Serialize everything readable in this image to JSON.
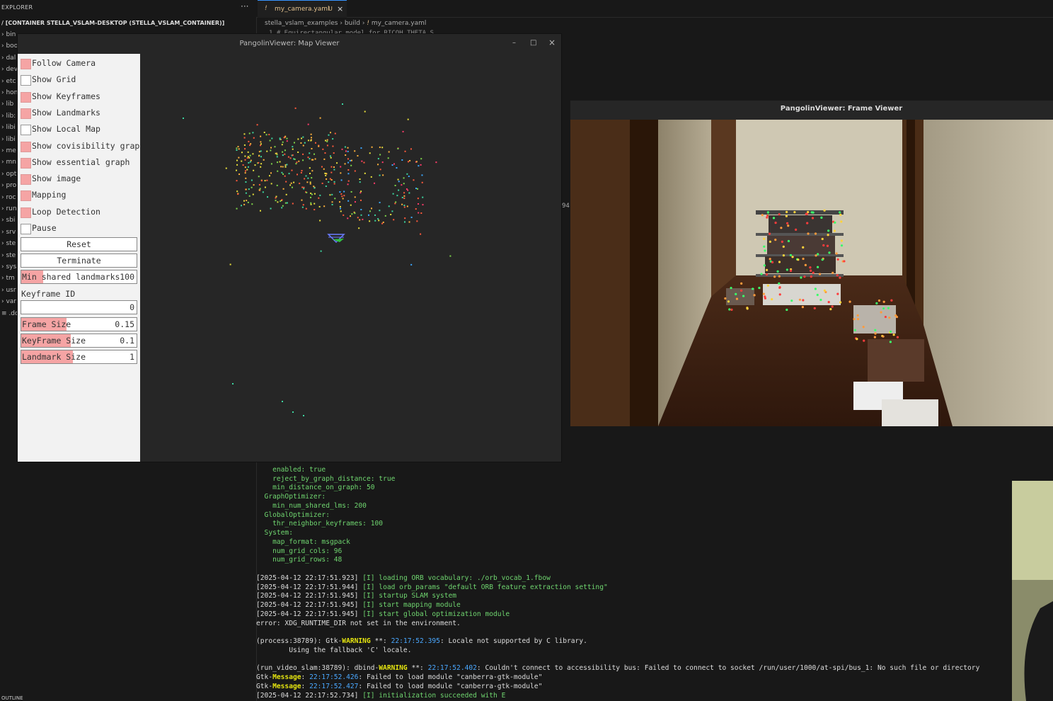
{
  "explorer": {
    "title": "EXPLORER",
    "more": "···",
    "root": "/ [CONTAINER STELLA_VSLAM-DESKTOP (STELLA_VSLAM_CONTAINER)]",
    "items": [
      "bin",
      "boo",
      "dal",
      "dev",
      "etc",
      "hon",
      "lib",
      "lib:",
      "libi",
      "libi",
      "me",
      "mn",
      "opt",
      "pro",
      "roc",
      "run",
      "sbi",
      "srv",
      "ste",
      "ste",
      "sys",
      "tm",
      "usr",
      "var",
      ".do"
    ],
    "outline": "OUTLINE"
  },
  "editor": {
    "tab": {
      "icon": "!",
      "name": "my_camera.yaml",
      "modified": "U",
      "close": "×"
    },
    "breadcrumb": {
      "seg1": "stella_vslam_examples",
      "seg2": "build",
      "file_icon": "!",
      "seg3": "my_camera.yaml"
    },
    "peek": "1    # Equirectangular model for RICOH THETA S",
    "number94": "94"
  },
  "map_viewer": {
    "title": "PangolinViewer: Map Viewer",
    "controls": {
      "minimize": "–",
      "maximize": "□",
      "close": "×"
    },
    "checkboxes": [
      {
        "label": "Follow Camera",
        "checked": true
      },
      {
        "label": "Show Grid",
        "checked": false
      },
      {
        "label": "Show Keyframes",
        "checked": true
      },
      {
        "label": "Show Landmarks",
        "checked": true
      },
      {
        "label": "Show Local Map",
        "checked": false
      },
      {
        "label": "Show covisibility graph",
        "checked": true
      },
      {
        "label": "Show essential graph",
        "checked": true
      },
      {
        "label": "Show image",
        "checked": true
      },
      {
        "label": "Mapping",
        "checked": true
      },
      {
        "label": "Loop Detection",
        "checked": true
      },
      {
        "label": "Pause",
        "checked": false
      }
    ],
    "buttons": {
      "reset": "Reset",
      "terminate": "Terminate"
    },
    "min_shared": {
      "label": "Min shared landmarks",
      "value": "100",
      "fill": 0.19
    },
    "keyframe_id": {
      "label": "Keyframe ID",
      "value": "0"
    },
    "frame_size": {
      "label": "Frame Size",
      "value": "0.15",
      "fill": 0.39
    },
    "keyframe_size": {
      "label": "KeyFrame Size",
      "value": "0.1",
      "fill": 0.43
    },
    "landmark_size": {
      "label": "Landmark Size",
      "value": "1",
      "fill": 0.45
    }
  },
  "frame_viewer": {
    "title": "PangolinViewer: Frame Viewer"
  },
  "terminal": {
    "config": [
      "    enabled: true",
      "    reject_by_graph_distance: true",
      "    min_distance_on_graph: 50",
      "  GraphOptimizer:",
      "    min_num_shared_lms: 200",
      "  GlobalOptimizer:",
      "    thr_neighbor_keyframes: 100",
      "  System:",
      "    map_format: msgpack",
      "    num_grid_cols: 96",
      "    num_grid_rows: 48"
    ],
    "log": [
      {
        "ts": "[2025-04-12 22:17:51.923]",
        "tag": "[I]",
        "msg": "loading ORB vocabulary: ./orb_vocab_1.fbow"
      },
      {
        "ts": "[2025-04-12 22:17:51.944]",
        "tag": "[I]",
        "msg": "load orb_params \"default ORB feature extraction setting\""
      },
      {
        "ts": "[2025-04-12 22:17:51.945]",
        "tag": "[I]",
        "msg": "startup SLAM system"
      },
      {
        "ts": "[2025-04-12 22:17:51.945]",
        "tag": "[I]",
        "msg": "start mapping module"
      },
      {
        "ts": "[2025-04-12 22:17:51.945]",
        "tag": "[I]",
        "msg": "start global optimization module"
      }
    ],
    "error_line": "error: XDG_RUNTIME_DIR not set in the environment.",
    "gtk_warn": {
      "pre": "(process:38789): Gtk-",
      "level": "WARNING",
      "mid": " **: ",
      "time": "22:17:52.395",
      "msg": ": Locale not supported by C library."
    },
    "fallback": "        Using the fallback 'C' locale.",
    "dbind_warn": {
      "pre": "(run_video_slam:38789): dbind-",
      "level": "WARNING",
      "mid": " **: ",
      "time": "22:17:52.402",
      "msg": ": Couldn't connect to accessibility bus: Failed to connect to socket /run/user/1000/at-spi/bus_1: No such file or directory"
    },
    "gtk_msgs": [
      {
        "pre": "Gtk-",
        "level": "Message",
        "mid": ": ",
        "time": "22:17:52.426",
        "msg": ": Failed to load module \"canberra-gtk-module\""
      },
      {
        "pre": "Gtk-",
        "level": "Message",
        "mid": ": ",
        "time": "22:17:52.427",
        "msg": ": Failed to load module \"canberra-gtk-module\""
      }
    ],
    "last": {
      "ts": "[2025-04-12 22:17:52.734]",
      "tag": "[I]",
      "msg": "initialization succeeded with E"
    }
  }
}
